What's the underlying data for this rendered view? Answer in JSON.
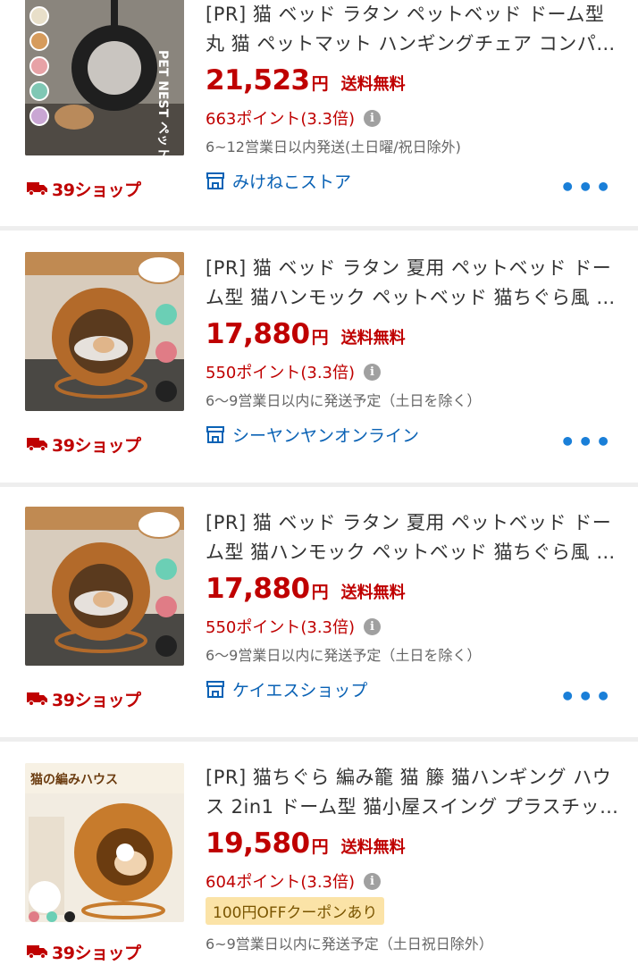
{
  "badge_label": "39ショップ",
  "more_label": "•••",
  "info_icon_text": "i",
  "colors": {
    "price": "#bf0000",
    "shop": "#0a62b5",
    "more": "#1a7fd8",
    "coupon_bg": "#fbe3a7"
  },
  "items": [
    {
      "title": "[PR] 猫 ベッド ラタン ペットベッド ドーム型 丸 猫 ペットマット ハンギングチェア コンパ…",
      "price": "21,523",
      "yen": "円",
      "shipping": "送料無料",
      "points": "663ポイント(3.3倍)",
      "delivery": "6~12営業日以内発送(土日曜/祝日除外)",
      "shop": "みけねこストア",
      "image_text": "PET NEST ペットハウス"
    },
    {
      "title": "[PR] 猫 ベッド ラタン 夏用 ペットベッド ドーム型 猫ハンモック ペットベッド 猫ちぐら風 …",
      "price": "17,880",
      "yen": "円",
      "shipping": "送料無料",
      "points": "550ポイント(3.3倍)",
      "delivery": "6～9営業日以内に発送予定（土日を除く）",
      "shop": "シーヤンヤンオンライン"
    },
    {
      "title": "[PR] 猫 ベッド ラタン 夏用 ペットベッド ドーム型 猫ハンモック ペットベッド 猫ちぐら風 …",
      "price": "17,880",
      "yen": "円",
      "shipping": "送料無料",
      "points": "550ポイント(3.3倍)",
      "delivery": "6～9営業日以内に発送予定（土日を除く）",
      "shop": "ケイエスショップ"
    },
    {
      "title": "[PR] 猫ちぐら 編み籠 猫 籐 猫ハンギング ハウス 2in1 ドーム型 猫小屋スイング プラスチッ…",
      "price": "19,580",
      "yen": "円",
      "shipping": "送料無料",
      "points": "604ポイント(3.3倍)",
      "coupon": "100円OFFクーポンあり",
      "delivery": "6~9営業日以内に発送予定（土日祝日除外）",
      "image_text": "猫の編みハウス"
    }
  ]
}
